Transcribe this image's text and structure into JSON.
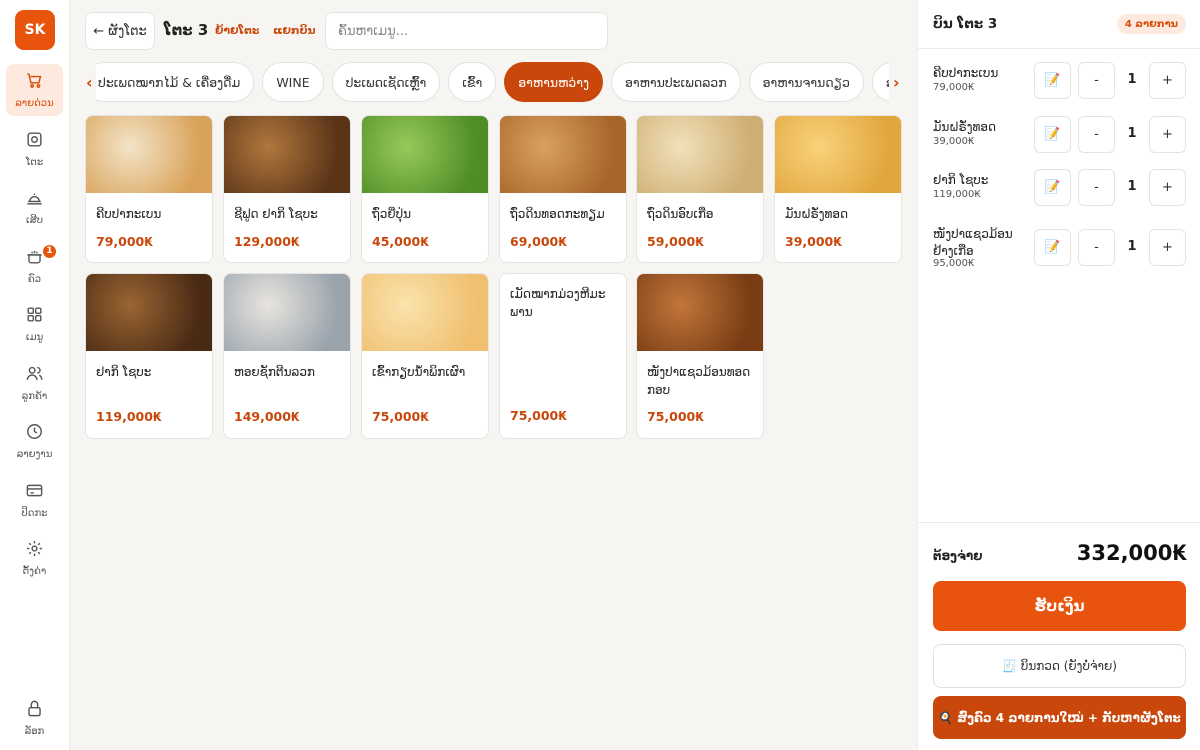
{
  "brand": {
    "logo_text": "SK",
    "accent": "#e8540e",
    "accent_dark": "#c9470b"
  },
  "sidebar": {
    "items": [
      {
        "label": "ລາຍດ່ວນ",
        "icon": "cart-icon",
        "active": true
      },
      {
        "label": "ໂຕະ",
        "icon": "table-icon"
      },
      {
        "label": "ເສີບ",
        "icon": "cloche-icon"
      },
      {
        "label": "ຄົວ",
        "icon": "pot-icon",
        "badge": "1"
      },
      {
        "label": "ເມນູ",
        "icon": "grid-icon"
      },
      {
        "label": "ລູກຄ້າ",
        "icon": "users-icon"
      },
      {
        "label": "ລາຍງານ",
        "icon": "clock-icon"
      },
      {
        "label": "ປິດກະ",
        "icon": "card-icon"
      },
      {
        "label": "ຕັ້ງຄ່າ",
        "icon": "gear-icon"
      }
    ],
    "lock_label": "ລັອກ"
  },
  "topbar": {
    "back_label": "← ຜັງໂຕະ",
    "table_title": "ໂຕະ 3",
    "move_label": "ຍ້າຍໂຕະ",
    "split_label": "ແຍກບິນ",
    "search_placeholder": "ຄົ້ນຫາເມນູ..."
  },
  "categories": [
    {
      "label": "ປະເພດໝາກໄມ້ & ເຄື່ອງດື່ມ"
    },
    {
      "label": "WINE"
    },
    {
      "label": "ປະເພດເຊັດເຫຼົ້າ"
    },
    {
      "label": "ເຂົ້າ"
    },
    {
      "label": "ອາຫານຫວ່າງ",
      "active": true
    },
    {
      "label": "ອາຫານປະເພດລວກ"
    },
    {
      "label": "ອາຫານຈານດຽວ"
    },
    {
      "label": "ອາຫານປະເພດລາບ"
    }
  ],
  "products": [
    {
      "name": "ຄີບປາກະເບນ",
      "price": "79,000₭",
      "image": "fish-skin-crisps",
      "colors": [
        "#d9a25a",
        "#f3e4c7"
      ]
    },
    {
      "name": "ຊີຟູດ ຢາກິ ໂຊບະ",
      "price": "129,000₭",
      "image": "seafood-yakisoba",
      "colors": [
        "#5b3418",
        "#b0773d"
      ]
    },
    {
      "name": "ຖົ່ວຍີ່ປຸ່ນ",
      "price": "45,000₭",
      "image": "edamame",
      "colors": [
        "#4f8e25",
        "#98c95c"
      ]
    },
    {
      "name": "ຖົ່ວດິນທອດກະທຽມ",
      "price": "69,000₭",
      "image": "garlic-fried-peanuts",
      "colors": [
        "#a8652a",
        "#d9a15d"
      ]
    },
    {
      "name": "ຖົ່ວດິນອົບເກືອ",
      "price": "59,000₭",
      "image": "salted-peanuts",
      "colors": [
        "#cfae73",
        "#f1e1bb"
      ]
    },
    {
      "name": "ມັນຝຣັ່ງທອດ",
      "price": "39,000₭",
      "image": "french-fries",
      "colors": [
        "#e2a63e",
        "#f8d27a"
      ]
    },
    {
      "name": "ຢາກິ ໂຊບະ",
      "price": "119,000₭",
      "image": "yakisoba",
      "colors": [
        "#4a2a14",
        "#9a6533"
      ]
    },
    {
      "name": "ຫອຍຊັກຕີນລວກ",
      "price": "149,000₭",
      "image": "boiled-conch",
      "colors": [
        "#9aa4ad",
        "#e8e4de"
      ]
    },
    {
      "name": "ເຂົ້າກຽບນ້ຳພິກເຜົາ",
      "price": "75,000₭",
      "image": "prawn-crackers",
      "colors": [
        "#f0c070",
        "#fae3ac"
      ]
    },
    {
      "name": "ເມັດໝາກມ່ວງຫີມະພານ",
      "price": "75,000₭",
      "image": ""
    },
    {
      "name": "ໜັງປາແຊວມ້ອນທອດກອບ",
      "price": "75,000₭",
      "image": "crispy-fish-skin",
      "colors": [
        "#7a3c14",
        "#c2763a"
      ]
    }
  ],
  "order": {
    "title": "ບິນ ໂຕະ 3",
    "count_badge": "4 ລາຍການ",
    "note_icon": "📝",
    "minus_label": "-",
    "plus_label": "+",
    "lines": [
      {
        "name": "ຄີບປາກະເບນ",
        "price": "79,000₭",
        "qty": "1"
      },
      {
        "name": "ມັນຝຣັ່ງທອດ",
        "price": "39,000₭",
        "qty": "1"
      },
      {
        "name": "ຢາກິ ໂຊບະ",
        "price": "119,000₭",
        "qty": "1"
      },
      {
        "name": "ໜັງປາແຊວມ້ອນຢ້າງເກືອ",
        "price": "95,000₭",
        "qty": "1"
      }
    ],
    "total_label": "ຕ້ອງຈ່າຍ",
    "total_value": "332,000₭",
    "pay_label": "ຮັບເງິນ",
    "bill_label": "🧾 ບິນກວດ (ຍັງບໍ່ຈ່າຍ)",
    "kitchen_label": "🍳 ສົ່ງຄົວ 4 ລາຍການໃໝ່ + ກັບຫາຜັງໂຕະ"
  }
}
